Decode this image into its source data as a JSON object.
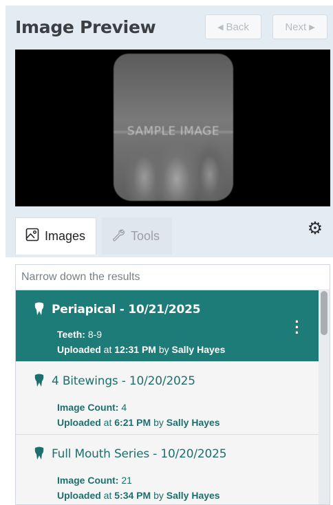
{
  "header": {
    "title": "Image Preview",
    "back_label": "Back",
    "next_label": "Next"
  },
  "preview": {
    "watermark": "SAMPLE IMAGE"
  },
  "tabs": [
    {
      "label": "Images",
      "icon": "image-icon",
      "active": true
    },
    {
      "label": "Tools",
      "icon": "wrench-icon",
      "active": false
    }
  ],
  "settings_icon": "gear-icon",
  "search": {
    "placeholder": "Narrow down the results",
    "value": ""
  },
  "items": [
    {
      "title": "Periapical - 10/21/2025",
      "detail_label": "Teeth:",
      "detail_value": "8-9",
      "uploaded_prefix": "Uploaded",
      "uploaded_at_word": "at",
      "uploaded_time": "12:31 PM",
      "by_word": "by",
      "uploaded_by": "Sally Hayes",
      "selected": true
    },
    {
      "title": "4 Bitewings - 10/20/2025",
      "detail_label": "Image Count:",
      "detail_value": "4",
      "uploaded_prefix": "Uploaded",
      "uploaded_at_word": "at",
      "uploaded_time": "6:21 PM",
      "by_word": "by",
      "uploaded_by": "Sally Hayes",
      "selected": false
    },
    {
      "title": "Full Mouth Series - 10/20/2025",
      "detail_label": "Image Count:",
      "detail_value": "21",
      "uploaded_prefix": "Uploaded",
      "uploaded_at_word": "at",
      "uploaded_time": "5:34 PM",
      "by_word": "by",
      "uploaded_by": "Sally Hayes",
      "selected": false
    }
  ],
  "colors": {
    "accent": "#1d7b78",
    "header_bg": "#e3ecf3"
  }
}
